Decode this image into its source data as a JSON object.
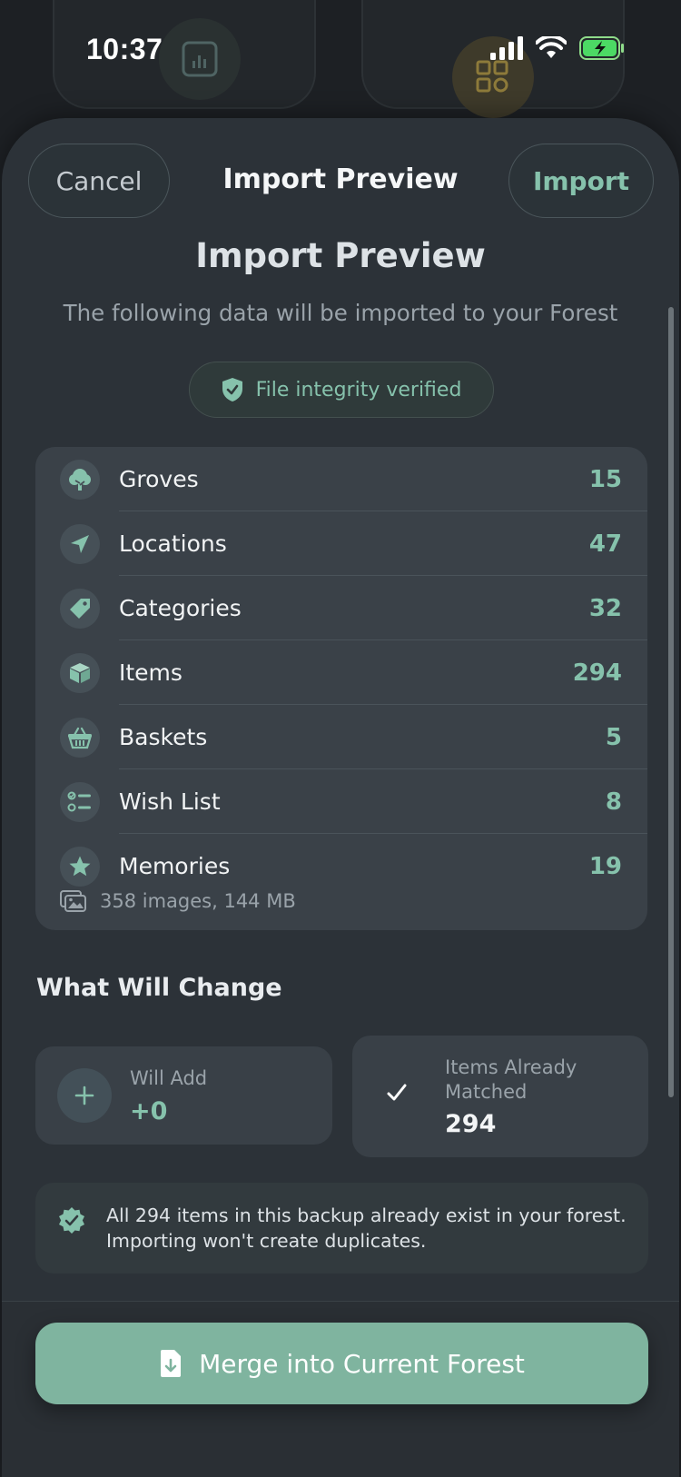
{
  "status_bar": {
    "time": "10:37"
  },
  "nav": {
    "cancel_label": "Cancel",
    "title": "Import Preview",
    "import_label": "Import"
  },
  "header": {
    "title": "Import Preview",
    "subtitle": "The following data will be imported to your Forest",
    "verified_label": "File integrity verified"
  },
  "summary": {
    "rows": [
      {
        "icon": "tree-icon",
        "label": "Groves",
        "count": "15"
      },
      {
        "icon": "location-arrow-icon",
        "label": "Locations",
        "count": "47"
      },
      {
        "icon": "tag-icon",
        "label": "Categories",
        "count": "32"
      },
      {
        "icon": "box-icon",
        "label": "Items",
        "count": "294"
      },
      {
        "icon": "basket-icon",
        "label": "Baskets",
        "count": "5"
      },
      {
        "icon": "checklist-icon",
        "label": "Wish List",
        "count": "8"
      },
      {
        "icon": "star-icon",
        "label": "Memories",
        "count": "19"
      }
    ],
    "images_line": "358 images, 144 MB"
  },
  "changes": {
    "section_title": "What Will Change",
    "add_label": "Will Add",
    "add_value": "+0",
    "matched_label": "Items Already Matched",
    "matched_value": "294"
  },
  "notice": {
    "text": "All 294 items in this backup already exist in your forest. Importing won't create duplicates."
  },
  "merge_button": {
    "label": "Merge into Current Forest"
  },
  "colors": {
    "accent": "#86c2ac",
    "button": "#7fb49f",
    "sheet": "#2c3238",
    "card": "#3a4148"
  }
}
